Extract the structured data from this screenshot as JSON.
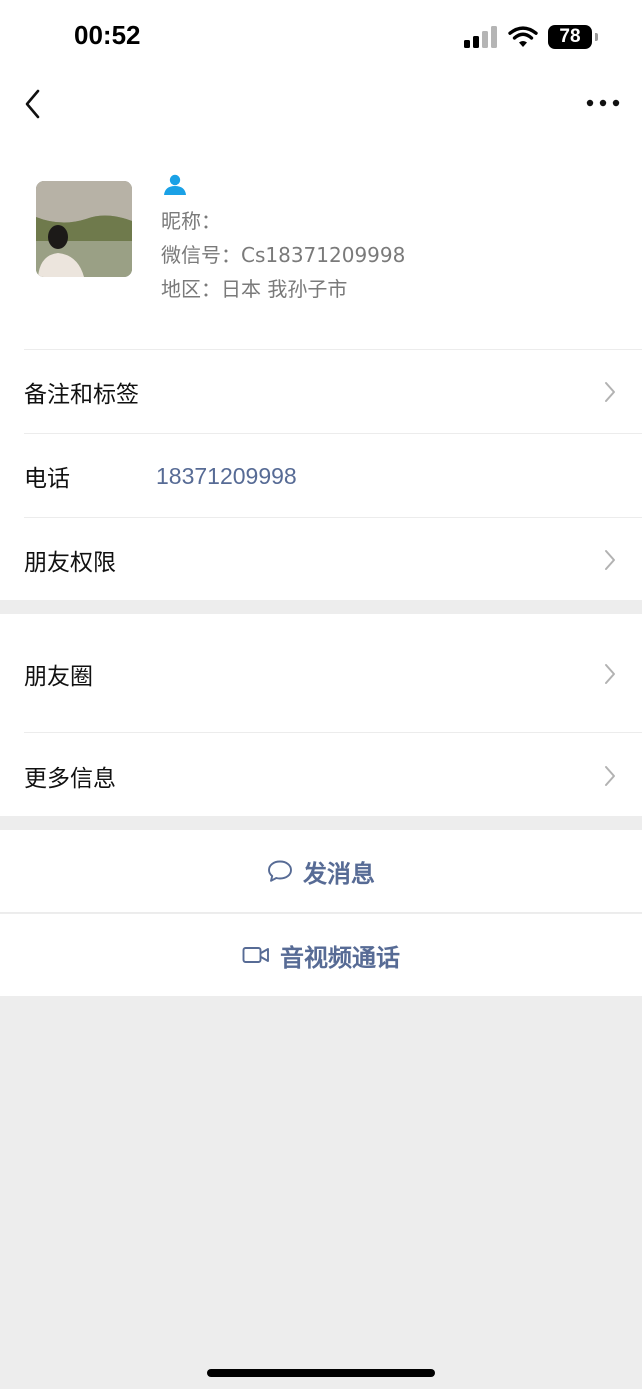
{
  "status_bar": {
    "time": "00:52",
    "battery": "78",
    "icons": [
      "signal-icon",
      "wifi-icon",
      "battery-icon"
    ]
  },
  "nav": {
    "back_icon": "chevron-left-icon",
    "more_icon": "more-dots-icon"
  },
  "profile": {
    "contact_icon": "contact-person-icon",
    "nickname": "昵称：",
    "wechat_id": "微信号：Cs18371209998",
    "region": "地区：日本 我孙子市"
  },
  "rows": {
    "remark_tags": "备注和标签",
    "phone_label": "电话",
    "phone_value": "18371209998",
    "friend_permissions": "朋友权限",
    "moments": "朋友圈",
    "more_info": "更多信息"
  },
  "actions": {
    "send_message": "发消息",
    "video_call": "音视频通话"
  },
  "colors": {
    "link_blue": "#576b95",
    "background_gray": "#ededed",
    "accent_blue": "#1aa1e6"
  }
}
